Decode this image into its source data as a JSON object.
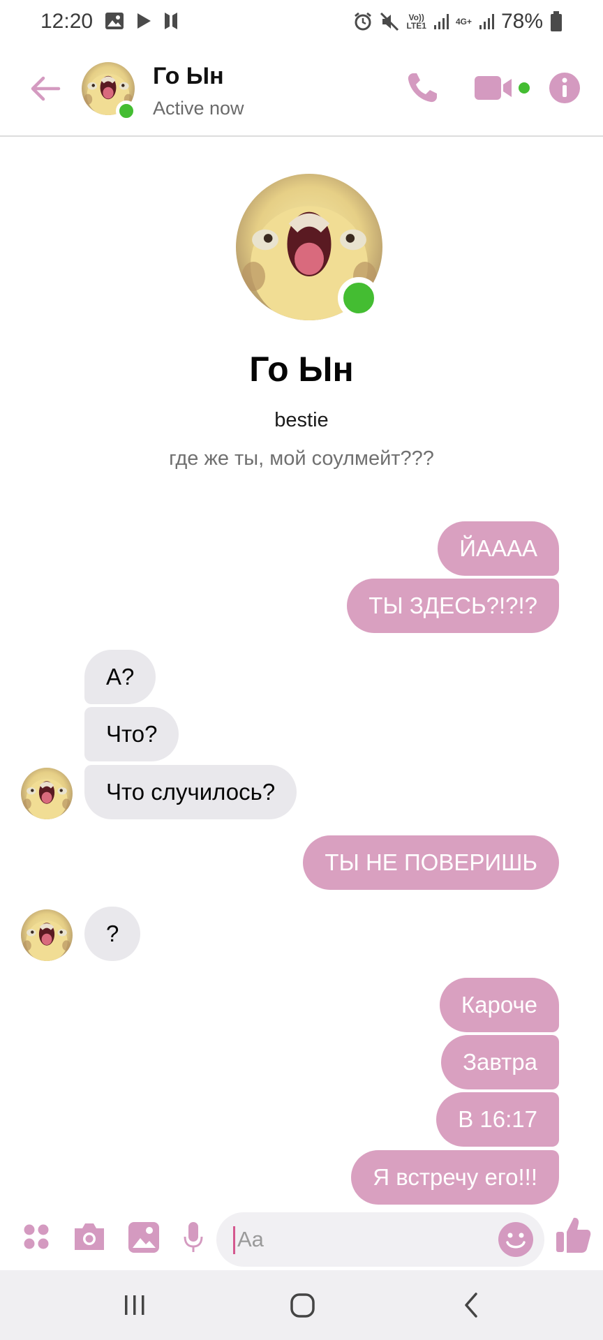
{
  "status_bar": {
    "time": "12:20",
    "battery_percent": "78%",
    "volte": "Vo))\nLTE1",
    "network": "4G+"
  },
  "header": {
    "contact_name": "Го Ын",
    "status": "Active now"
  },
  "profile": {
    "name": "Го Ын",
    "nickname": "bestie",
    "bio": "где же ты, мой соулмейт???"
  },
  "messages": [
    {
      "side": "out",
      "text": "ЙАААА"
    },
    {
      "side": "out",
      "text": "ТЫ ЗДЕСЬ?!?!?"
    },
    {
      "side": "in",
      "text": "А?"
    },
    {
      "side": "in",
      "text": "Что?"
    },
    {
      "side": "in",
      "text": "Что случилось?"
    },
    {
      "side": "out",
      "text": "ТЫ НЕ ПОВЕРИШЬ"
    },
    {
      "side": "in",
      "text": "?"
    },
    {
      "side": "out",
      "text": "Кароче"
    },
    {
      "side": "out",
      "text": "Завтра"
    },
    {
      "side": "out",
      "text": "В 16:17"
    },
    {
      "side": "out",
      "text": "Я встречу его!!!"
    }
  ],
  "composer": {
    "placeholder": "Aa"
  },
  "colors": {
    "accent": "#d9a0c0",
    "icon_accent": "#d49ac0",
    "online": "#44bd32",
    "incoming_bubble": "#e9e8ec"
  },
  "icons": [
    "back-arrow-icon",
    "phone-icon",
    "video-camera-icon",
    "info-icon",
    "apps-icon",
    "camera-icon",
    "gallery-icon",
    "microphone-icon",
    "emoji-icon",
    "thumbs-up-icon",
    "recent-apps-icon",
    "home-icon",
    "back-nav-icon"
  ]
}
